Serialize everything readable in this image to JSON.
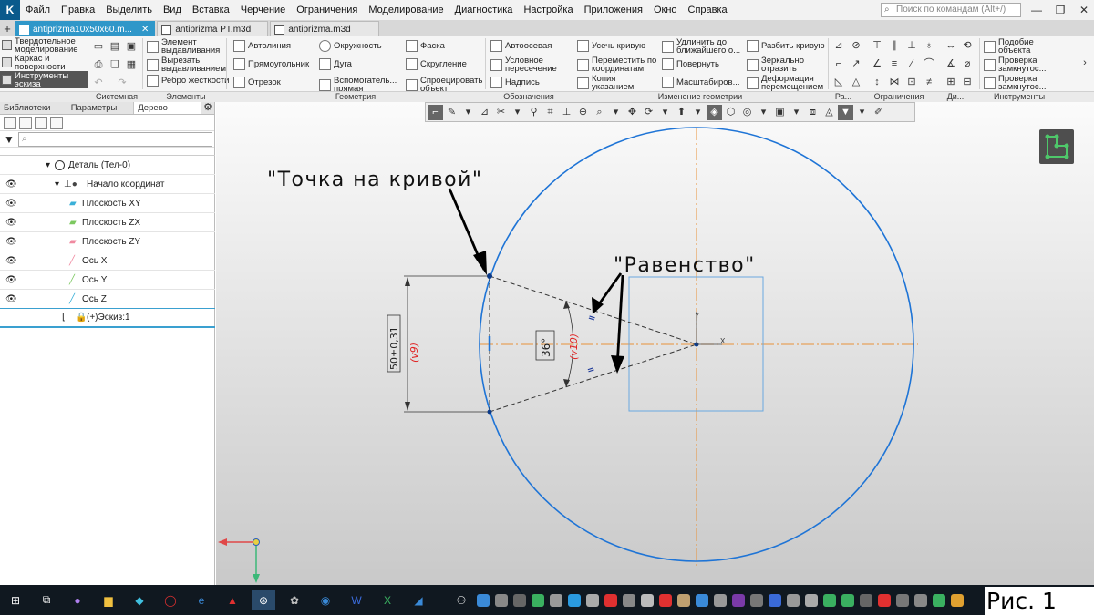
{
  "menu": {
    "items": [
      "Файл",
      "Правка",
      "Выделить",
      "Вид",
      "Вставка",
      "Черчение",
      "Ограничения",
      "Моделирование",
      "Диагностика",
      "Настройка",
      "Приложения",
      "Окно",
      "Справка"
    ],
    "search_placeholder": "Поиск по командам (Alt+/)"
  },
  "tabs": [
    {
      "label": "antiprizma10x50x60.m...",
      "active": true
    },
    {
      "label": "antiprizma PT.m3d",
      "active": false
    },
    {
      "label": "antiprizma.m3d",
      "active": false
    }
  ],
  "ribbon": {
    "modes": [
      "Твердотельное моделирование",
      "Каркас и поверхности",
      "Инструменты эскиза"
    ],
    "elements": [
      "Элемент выдавливания",
      "Вырезать выдавливанием",
      "Ребро жесткости"
    ],
    "geometry": [
      "Автолиния",
      "Окружность",
      "Фаска",
      "Прямоугольник",
      "Дуга",
      "Скругление",
      "Отрезок",
      "Вспомогатель... прямая",
      "Спроецировать объект"
    ],
    "designations": [
      "Автоосевая",
      "Условное пересечение",
      "Надпись"
    ],
    "geom_edit": [
      "Усечь кривую",
      "Удлинить до ближайшего о...",
      "Разбить кривую",
      "Переместить по координатам",
      "Повернуть",
      "Зеркально отразить",
      "Копия указанием",
      "Масштабиров...",
      "Деформация перемещением"
    ],
    "tools": [
      "Подобие объекта",
      "Проверка замкнутос...",
      "Проверка замкнутос..."
    ],
    "group_labels": [
      "Системная",
      "Элементы",
      "Геометрия",
      "Обозначения",
      "Изменение геометрии",
      "Ра...",
      "Ограничения",
      "Ди...",
      "Инструменты"
    ]
  },
  "panel": {
    "tabs": [
      "Библиотеки",
      "Параметры",
      "Дерево"
    ],
    "tree": [
      {
        "label": "Деталь (Тел-0)",
        "eye": false
      },
      {
        "label": "Начало координат",
        "eye": true
      },
      {
        "label": "Плоскость XY",
        "eye": true
      },
      {
        "label": "Плоскость ZX",
        "eye": true
      },
      {
        "label": "Плоскость ZY",
        "eye": true
      },
      {
        "label": "Ось X",
        "eye": true
      },
      {
        "label": "Ось Y",
        "eye": true
      },
      {
        "label": "Ось Z",
        "eye": true
      },
      {
        "label": "(+)Эскиз:1",
        "eye": false
      }
    ]
  },
  "drawing": {
    "annotation_point": "\"Точка на кривой\"",
    "annotation_equal": "\"Равенство\"",
    "dim_linear": "50±0,31",
    "dim_linear_var": "(v9)",
    "dim_angle": "36°",
    "dim_angle_var": "(v10)",
    "axis_x": "X",
    "axis_y": "Y",
    "equal_mark": "=",
    "colors": {
      "circle": "#1e74d6",
      "centerline": "#e8923a",
      "dim_red": "#e02020",
      "geometry": "#333333"
    }
  },
  "figure_label": "Рис. 1"
}
